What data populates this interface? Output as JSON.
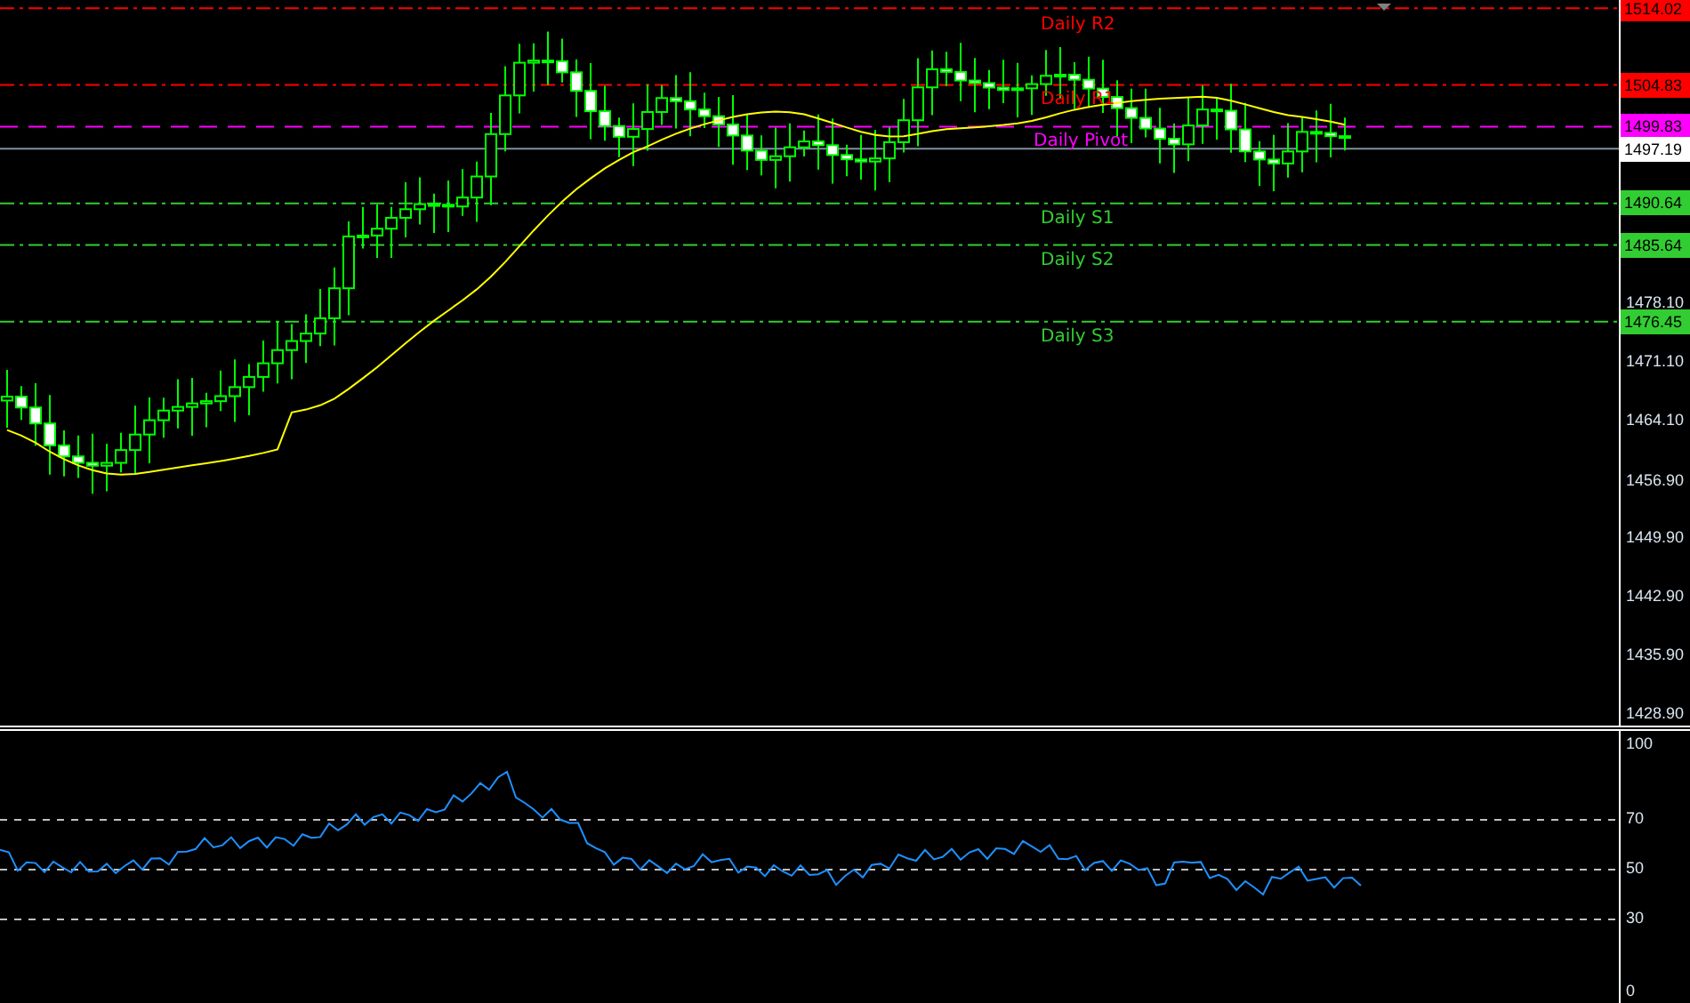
{
  "price_chart": {
    "levels": [
      {
        "label": "Daily R2",
        "price": "1514.02",
        "color": "#ff0000",
        "kind": "dashdot"
      },
      {
        "label": "Daily R1",
        "price": "1504.83",
        "color": "#ff0000",
        "kind": "dashdot"
      },
      {
        "label": "Daily Pivot",
        "price": "1499.83",
        "color": "#ff00ff",
        "kind": "dash"
      },
      {
        "label": "Daily S1",
        "price": "1490.64",
        "color": "#32cd32",
        "kind": "dashdot"
      },
      {
        "label": "Daily S2",
        "price": "1485.64",
        "color": "#32cd32",
        "kind": "dashdot"
      },
      {
        "label": "Daily S3",
        "price": "1476.45",
        "color": "#32cd32",
        "kind": "dashdot"
      }
    ],
    "current_price": "1497.19",
    "axis_ticks": [
      "1478.10",
      "1471.10",
      "1464.10",
      "1456.90",
      "1449.90",
      "1442.90",
      "1435.90",
      "1428.90"
    ]
  },
  "indicator": {
    "axis_ticks": [
      "100",
      "70",
      "50",
      "30",
      "0"
    ]
  }
}
